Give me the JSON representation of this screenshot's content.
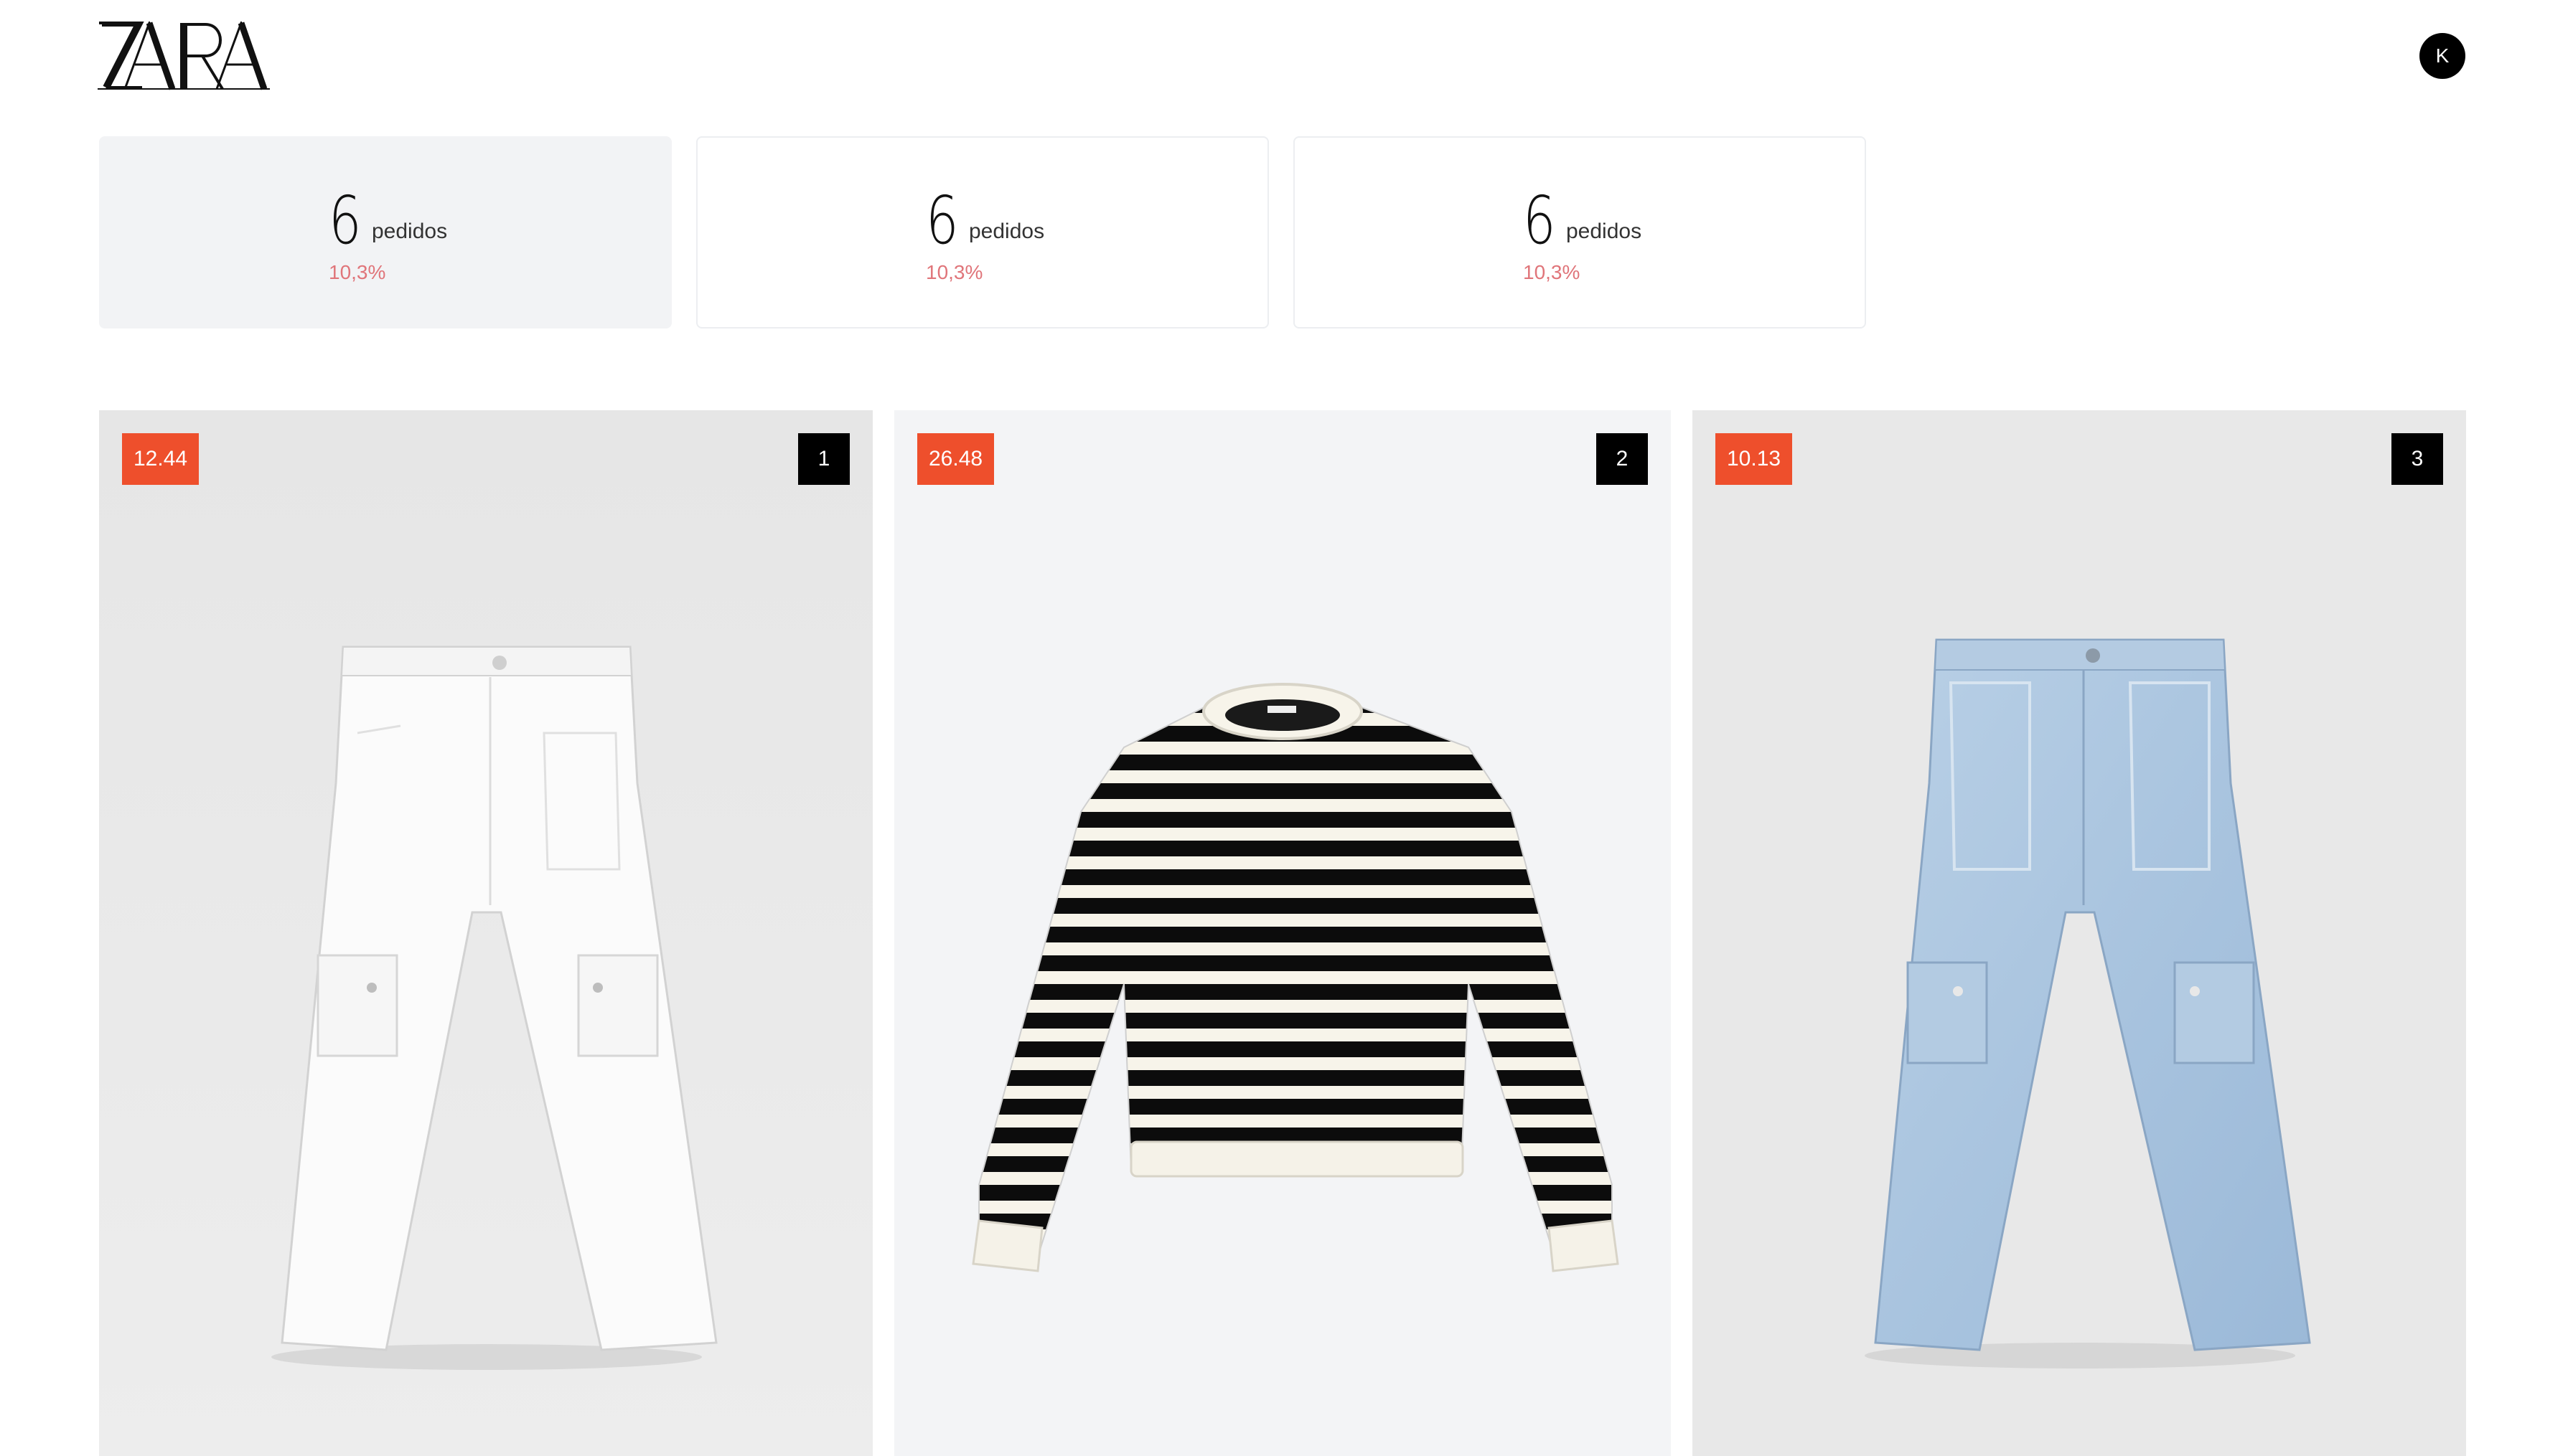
{
  "header": {
    "brand": "ZARA",
    "brand_icon": "zara-wordmark",
    "user_initial": "K"
  },
  "stats": [
    {
      "count": "6",
      "label": "pedidos",
      "percent": "10,3%",
      "selected": true
    },
    {
      "count": "6",
      "label": "pedidos",
      "percent": "10,3%",
      "selected": false
    },
    {
      "count": "6",
      "label": "pedidos",
      "percent": "10,3%",
      "selected": false
    }
  ],
  "products": [
    {
      "price": "12.44",
      "rank": "1",
      "image": "white-cargo-pants"
    },
    {
      "price": "26.48",
      "rank": "2",
      "image": "black-white-striped-sweatshirt"
    },
    {
      "price": "10.13",
      "rank": "3",
      "image": "light-blue-cargo-jeans"
    }
  ],
  "colors": {
    "accent": "#ee4f2c",
    "percent": "#e0757a",
    "card_selected": "#f2f3f5",
    "rank_badge": "#000000"
  }
}
